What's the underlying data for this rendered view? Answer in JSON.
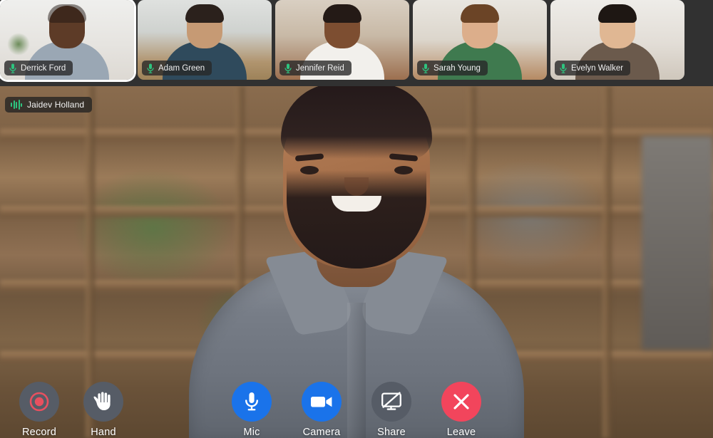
{
  "meeting": {
    "active_speaker": {
      "name": "Jaidev Holland",
      "audio_indicator": "waveform-icon",
      "speaking": true
    },
    "participant_strip": [
      {
        "name": "Derrick Ford",
        "mic_icon": "microphone-icon",
        "mic_muted": false,
        "highlighted": true
      },
      {
        "name": "Adam Green",
        "mic_icon": "microphone-icon",
        "mic_muted": false,
        "highlighted": false
      },
      {
        "name": "Jennifer Reid",
        "mic_icon": "microphone-icon",
        "mic_muted": false,
        "highlighted": false
      },
      {
        "name": "Sarah Young",
        "mic_icon": "microphone-icon",
        "mic_muted": false,
        "highlighted": false
      },
      {
        "name": "Evelyn Walker",
        "mic_icon": "microphone-icon",
        "mic_muted": false,
        "highlighted": false
      }
    ]
  },
  "controls": {
    "left": [
      {
        "label": "Record",
        "icon": "record-icon",
        "style": "gray"
      },
      {
        "label": "Hand",
        "icon": "raise-hand-icon",
        "style": "gray"
      }
    ],
    "center": [
      {
        "label": "Mic",
        "icon": "microphone-icon",
        "style": "blue"
      },
      {
        "label": "Camera",
        "icon": "video-camera-icon",
        "style": "blue"
      },
      {
        "label": "Share",
        "icon": "screen-share-off-icon",
        "style": "gray"
      },
      {
        "label": "Leave",
        "icon": "close-x-icon",
        "style": "red"
      }
    ]
  },
  "colors": {
    "strip_background": "#313131",
    "badge_background": "rgba(40,40,40,0.80)",
    "mic_green": "#2ec47f",
    "accent_blue": "#1a73ea",
    "leave_red": "#f2455c",
    "neutral_gray": "#565c66",
    "record_red": "#e8505f",
    "text_white": "#ffffff",
    "active_border": "#ffffff"
  }
}
